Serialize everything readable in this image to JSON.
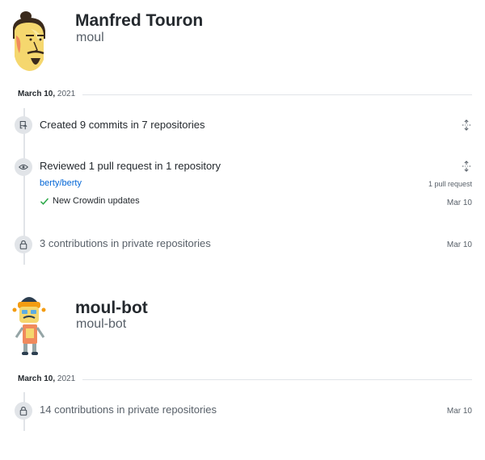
{
  "users": [
    {
      "name": "Manfred Touron",
      "login": "moul",
      "date": {
        "day": "March 10,",
        "year": "2021"
      },
      "events": {
        "commits": {
          "title": "Created 9 commits in 7 repositories"
        },
        "reviews": {
          "title": "Reviewed 1 pull request in 1 repository",
          "repo": "berty/berty",
          "count": "1 pull request",
          "pr_title": "New Crowdin updates",
          "pr_date": "Mar 10"
        },
        "private": {
          "title": "3 contributions in private repositories",
          "date": "Mar 10"
        }
      }
    },
    {
      "name": "moul-bot",
      "login": "moul-bot",
      "date": {
        "day": "March 10,",
        "year": "2021"
      },
      "events": {
        "private": {
          "title": "14 contributions in private repositories",
          "date": "Mar 10"
        }
      }
    }
  ],
  "colors": {
    "link": "#0366d6",
    "success": "#28a745",
    "muted": "#586069",
    "timeline": "#e1e4e8"
  },
  "icons": {
    "commits": "repo-push-icon",
    "review": "eye-icon",
    "private": "lock-icon",
    "fold": "unfold-icon",
    "check": "check-icon"
  }
}
